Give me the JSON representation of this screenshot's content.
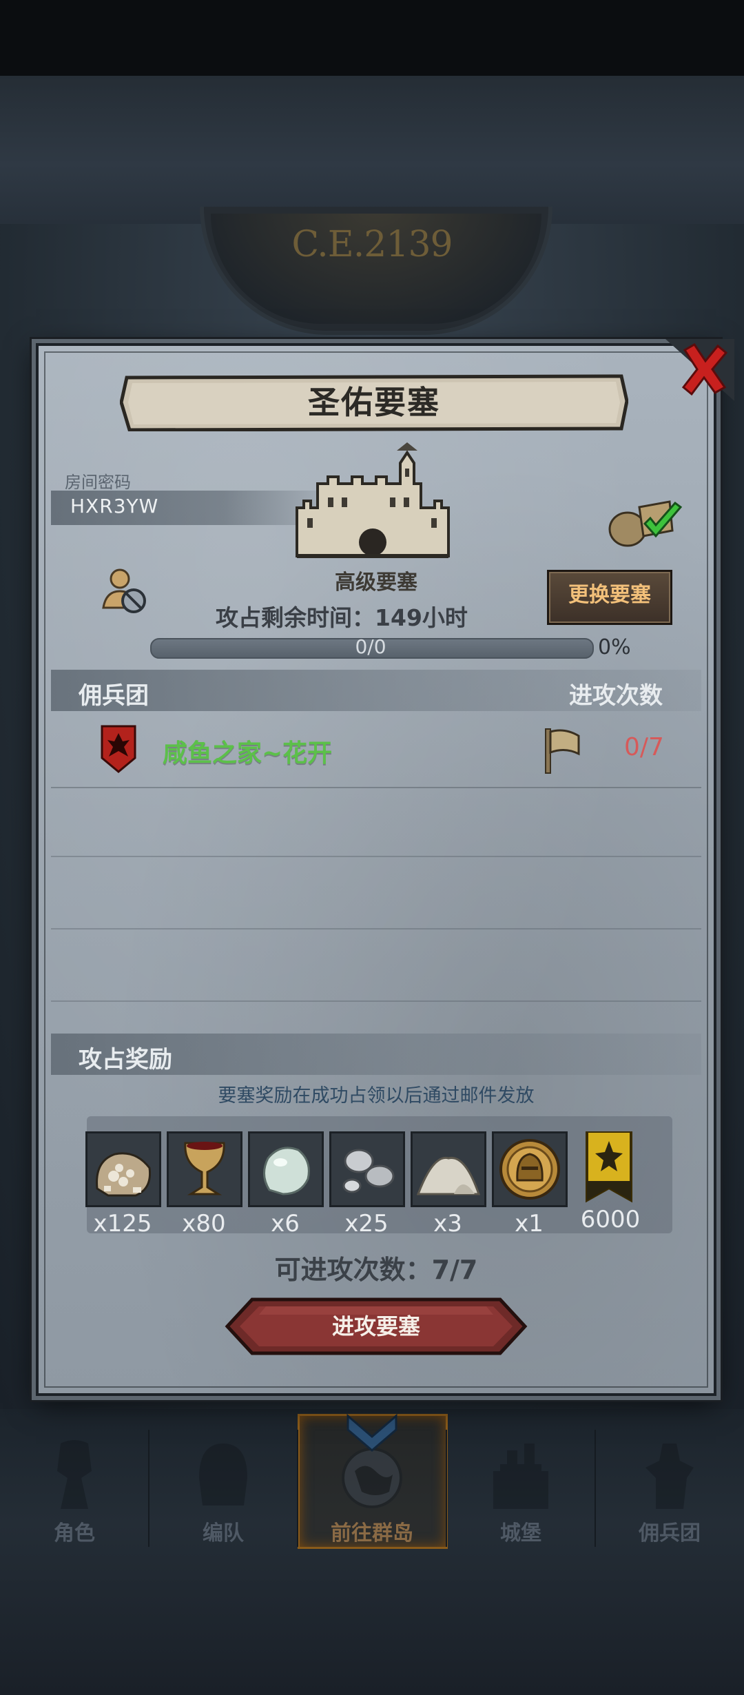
{
  "background": {
    "era_text": "C.E.2139"
  },
  "nav": {
    "items": [
      {
        "label": "角色",
        "icon": "knight-icon"
      },
      {
        "label": "编队",
        "icon": "helmet-icon"
      },
      {
        "label": "前往群岛",
        "icon": "globe-icon",
        "active": true
      },
      {
        "label": "城堡",
        "icon": "castle-icon"
      },
      {
        "label": "佣兵团",
        "icon": "mercenary-icon"
      }
    ]
  },
  "modal": {
    "title": "圣佑要塞",
    "room_label": "房间密码",
    "room_code": "HXR3YW",
    "fortress_type": "高级要塞",
    "change_button": "更换要塞",
    "countdown": "攻占剩余时间：149小时",
    "progress": {
      "text": "0/0",
      "percent_label": "0%",
      "value": 0
    },
    "mercenary_header": "佣兵团",
    "attacks_header": "进攻次数",
    "guilds": [
      {
        "name": "咸鱼之家~花开",
        "attacks": "0/7"
      }
    ],
    "reward_header": "攻占奖励",
    "reward_note": "要塞奖励在成功占领以后通过邮件发放",
    "rewards": [
      {
        "icon": "ore-sack-icon",
        "qty": "x125"
      },
      {
        "icon": "goblet-icon",
        "qty": "x80"
      },
      {
        "icon": "pearl-icon",
        "qty": "x6"
      },
      {
        "icon": "silver-orbs-icon",
        "qty": "x25"
      },
      {
        "icon": "powder-pile-icon",
        "qty": "x3"
      },
      {
        "icon": "gold-helmet-coin-icon",
        "qty": "x1"
      },
      {
        "icon": "honor-banner-icon",
        "qty": "6000"
      }
    ],
    "attempts_left": "可进攻次数：7/7",
    "attack_button": "进攻要塞"
  },
  "colors": {
    "guild_name": "#5cc04a",
    "attack_count": "#d65a5a",
    "change_button_text": "#f2c07a",
    "reward_note": "#2f4a63"
  }
}
